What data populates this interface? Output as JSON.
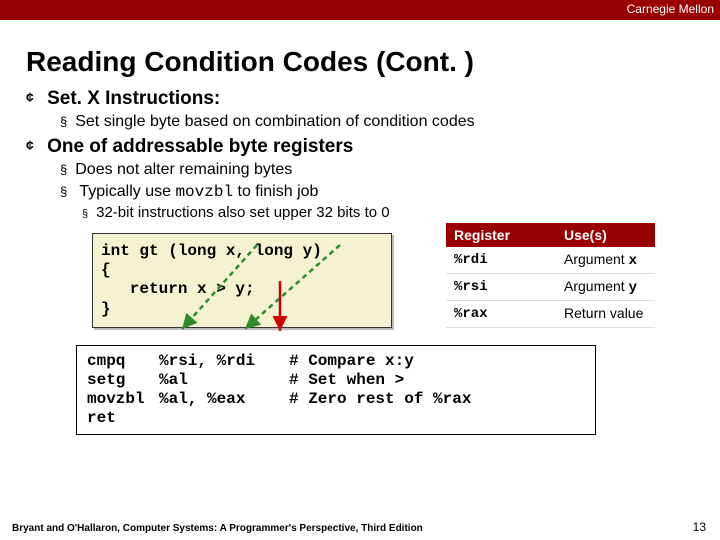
{
  "header": {
    "brand": "Carnegie Mellon"
  },
  "title": "Reading Condition Codes (Cont. )",
  "section1": {
    "heading": "Set. X Instructions:",
    "sub1": "Set single byte based on combination of condition codes"
  },
  "section2": {
    "heading": "One of addressable byte registers",
    "sub1": "Does not alter remaining bytes",
    "sub2_pre": "Typically use ",
    "sub2_code": "movzbl",
    "sub2_post": " to finish job",
    "subsub1": "32-bit instructions also set upper 32 bits to 0"
  },
  "code_c": "int gt (long x, long y)\n{\n   return x > y;\n}",
  "reg_table": {
    "headers": [
      "Register",
      "Use(s)"
    ],
    "rows": [
      {
        "reg": "%rdi",
        "use_pre": "Argument ",
        "use_code": "x"
      },
      {
        "reg": "%rsi",
        "use_pre": "Argument ",
        "use_code": "y"
      },
      {
        "reg": "%rax",
        "use_pre": "Return value",
        "use_code": ""
      }
    ]
  },
  "asm": [
    {
      "op": "cmpq",
      "args": "%rsi, %rdi",
      "comment": "# Compare x:y"
    },
    {
      "op": "setg",
      "args": "%al",
      "comment": "# Set when >"
    },
    {
      "op": "movzbl",
      "args": "%al, %eax",
      "comment": "# Zero rest of %rax"
    },
    {
      "op": "ret",
      "args": "",
      "comment": ""
    }
  ],
  "footer": "Bryant and O'Hallaron, Computer Systems: A Programmer's Perspective, Third Edition",
  "page_number": "13"
}
